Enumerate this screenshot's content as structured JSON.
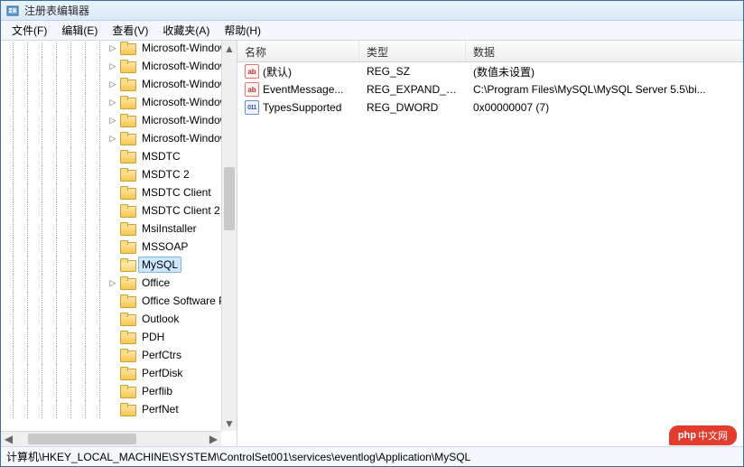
{
  "window": {
    "title": "注册表编辑器"
  },
  "menu": {
    "file": "文件(F)",
    "edit": "编辑(E)",
    "view": "查看(V)",
    "fav": "收藏夹(A)",
    "help": "帮助(H)"
  },
  "tree": {
    "indent_levels": 7,
    "items": [
      {
        "label": "Microsoft-Windows",
        "expander": "closed",
        "selected": false
      },
      {
        "label": "Microsoft-Windows",
        "expander": "closed",
        "selected": false
      },
      {
        "label": "Microsoft-Windows",
        "expander": "closed",
        "selected": false
      },
      {
        "label": "Microsoft-Windows",
        "expander": "closed",
        "selected": false
      },
      {
        "label": "Microsoft-Windows",
        "expander": "closed",
        "selected": false
      },
      {
        "label": "Microsoft-Windows",
        "expander": "closed",
        "selected": false
      },
      {
        "label": "MSDTC",
        "expander": "none",
        "selected": false
      },
      {
        "label": "MSDTC 2",
        "expander": "none",
        "selected": false
      },
      {
        "label": "MSDTC Client",
        "expander": "none",
        "selected": false
      },
      {
        "label": "MSDTC Client 2",
        "expander": "none",
        "selected": false
      },
      {
        "label": "MsiInstaller",
        "expander": "none",
        "selected": false
      },
      {
        "label": "MSSOAP",
        "expander": "none",
        "selected": false
      },
      {
        "label": "MySQL",
        "expander": "none",
        "selected": true
      },
      {
        "label": "Office",
        "expander": "closed",
        "selected": false
      },
      {
        "label": "Office Software Pro",
        "expander": "none",
        "selected": false
      },
      {
        "label": "Outlook",
        "expander": "none",
        "selected": false
      },
      {
        "label": "PDH",
        "expander": "none",
        "selected": false
      },
      {
        "label": "PerfCtrs",
        "expander": "none",
        "selected": false
      },
      {
        "label": "PerfDisk",
        "expander": "none",
        "selected": false
      },
      {
        "label": "Perflib",
        "expander": "none",
        "selected": false
      },
      {
        "label": "PerfNet",
        "expander": "none",
        "selected": false
      }
    ]
  },
  "list": {
    "columns": {
      "name": "名称",
      "type": "类型",
      "data": "数据"
    },
    "rows": [
      {
        "icon": "str",
        "icon_glyph": "ab",
        "name": "(默认)",
        "type": "REG_SZ",
        "data": "(数值未设置)"
      },
      {
        "icon": "str",
        "icon_glyph": "ab",
        "name": "EventMessage...",
        "type": "REG_EXPAND_SZ",
        "data": "C:\\Program Files\\MySQL\\MySQL Server 5.5\\bi..."
      },
      {
        "icon": "bin",
        "icon_glyph": "011",
        "name": "TypesSupported",
        "type": "REG_DWORD",
        "data": "0x00000007 (7)"
      }
    ]
  },
  "statusbar": {
    "path": "计算机\\HKEY_LOCAL_MACHINE\\SYSTEM\\ControlSet001\\services\\eventlog\\Application\\MySQL"
  },
  "watermark": {
    "brand": "php",
    "text": "中文网"
  }
}
